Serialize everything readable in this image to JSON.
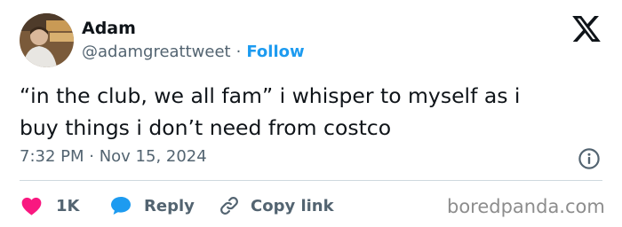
{
  "author": {
    "name": "Adam",
    "handle": "@adamgreattweet",
    "separator": "·",
    "follow_label": "Follow"
  },
  "tweet": {
    "text_lines": [
      "“in the club, we all fam” i whisper to myself as i",
      "buy things i don’t need from costco"
    ],
    "timestamp": "7:32 PM · Nov 15, 2024"
  },
  "actions": {
    "like_count": "1K",
    "reply_label": "Reply",
    "copy_link_label": "Copy link"
  },
  "watermark": "boredpanda.com",
  "icons": {
    "brand": "x-logo-icon",
    "info": "info-icon",
    "like": "heart-icon",
    "reply": "speech-bubble-icon",
    "copy": "link-icon"
  },
  "colors": {
    "text": "#0f1419",
    "secondary": "#536471",
    "accent": "#1d9bf0",
    "like": "#f91880",
    "divider": "#cfd9de",
    "watermark": "#8d8d8d"
  }
}
